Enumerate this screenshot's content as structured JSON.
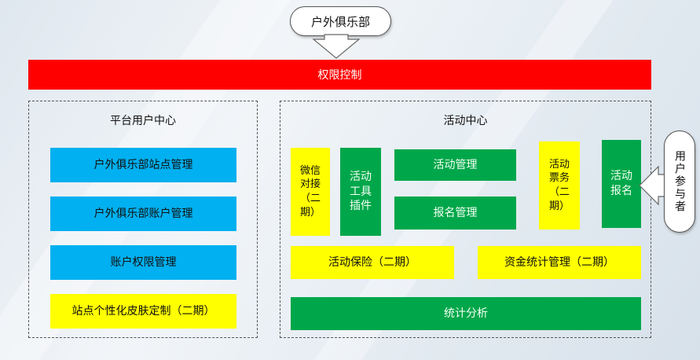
{
  "top_callout": "户外俱乐部",
  "permission_bar": "权限控制",
  "platform_center": {
    "title": "平台用户中心",
    "items": [
      "户外俱乐部站点管理",
      "户外俱乐部账户管理",
      "账户权限管理",
      "站点个性化皮肤定制（二期）"
    ]
  },
  "activity_center": {
    "title": "活动中心",
    "wechat": "微信\n对接\n（二\n期）",
    "plugin": "活动\n工具\n插件",
    "activity_mgmt": "活动管理",
    "signup_mgmt": "报名管理",
    "ticketing": "活动\n票务\n（二\n期）",
    "signup": "活动\n报名",
    "insurance": "活动保险（二期）",
    "finance": "资金统计管理（二期）",
    "analytics": "统计分析"
  },
  "side_callout": "用户参与者",
  "colors": {
    "red": "#ff0000",
    "blue": "#00b0f0",
    "yellow": "#ffff00",
    "green": "#00a74a"
  }
}
